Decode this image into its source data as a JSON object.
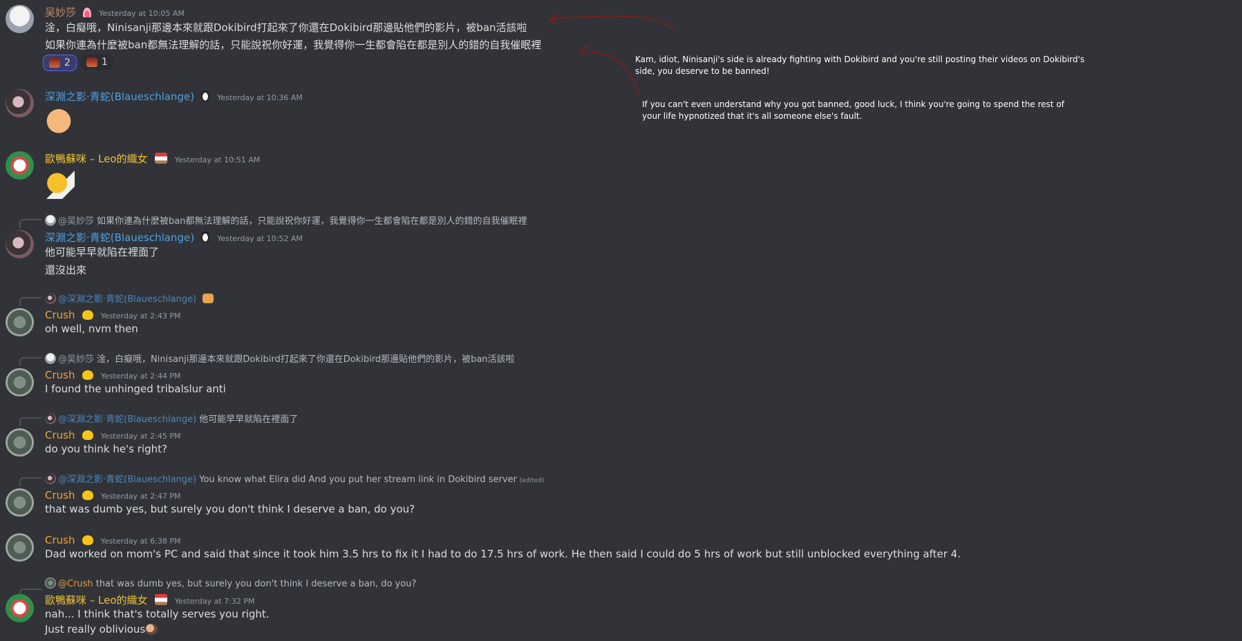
{
  "messages": [
    {
      "username": "吴妙莎",
      "timestamp": "Yesterday at 10:05 AM",
      "lines": [
        "淦，白癡哦，Ninisanji那邊本來就跟Dokibird打起來了你還在Dokibird那邊貼他們的影片，被ban活該啦",
        "如果你連為什麼被ban都無法理解的話，只能說祝你好運，我覺得你一生都會陷在都是別人的錯的自我催眠裡"
      ],
      "reactions": [
        {
          "count": "2"
        },
        {
          "count": "1"
        }
      ]
    },
    {
      "username": "深淵之影·青蛇(Blaueschlange)",
      "timestamp": "Yesterday at 10:36 AM"
    },
    {
      "username": "歐鴨蘇咪 – Leo的織女",
      "timestamp": "Yesterday at 10:51 AM"
    },
    {
      "reply": {
        "mention": "@吴妙莎",
        "text": "如果你連為什麼被ban都無法理解的話，只能說祝你好運，我覺得你一生都會陷在都是別人的錯的自我催眠裡"
      },
      "username": "深淵之影·青蛇(Blaueschlange)",
      "timestamp": "Yesterday at 10:52 AM",
      "lines": [
        "他可能早早就陷在裡面了",
        "還沒出來"
      ]
    },
    {
      "reply": {
        "mention": "@深淵之影·青蛇(Blaueschlange)",
        "text": ""
      },
      "username": "Crush",
      "timestamp": "Yesterday at 2:43 PM",
      "lines": [
        "oh well, nvm then"
      ]
    },
    {
      "reply": {
        "mention": "@吴妙莎",
        "text": "淦，白癡哦，Ninisanji那邊本來就跟Dokibird打起來了你還在Dokibird那邊貼他們的影片，被ban活該啦"
      },
      "username": "Crush",
      "timestamp": "Yesterday at 2:44 PM",
      "lines": [
        "I found the unhinged tribalslur anti"
      ]
    },
    {
      "reply": {
        "mention": "@深淵之影·青蛇(Blaueschlange)",
        "text": "他可能早早就陷在裡面了"
      },
      "username": "Crush",
      "timestamp": "Yesterday at 2:45 PM",
      "lines": [
        "do you think he's right?"
      ]
    },
    {
      "reply": {
        "mention": "@深淵之影·青蛇(Blaueschlange)",
        "text": "You know what Elira did And you put her stream link in Dokibird server",
        "edited": "(edited)"
      },
      "username": "Crush",
      "timestamp": "Yesterday at 2:47 PM",
      "lines": [
        "that was dumb yes, but surely you don't think I deserve a ban, do you?"
      ]
    },
    {
      "username": "Crush",
      "timestamp": "Yesterday at 6:38 PM",
      "lines": [
        "Dad worked on mom's PC and said that since it took him 3.5 hrs to fix it I had to do 17.5 hrs of work. He then said I could do 5 hrs of work but still unblocked everything after 4."
      ]
    },
    {
      "reply": {
        "mention": "@Crush",
        "text": "that was dumb yes, but surely you don't think I deserve a ban, do you?"
      },
      "username": "歐鴨蘇咪 – Leo的織女",
      "timestamp": "Yesterday at 7:32 PM",
      "lines": [
        "nah... I think that's totally serves you right.",
        "Just really oblivious"
      ]
    }
  ],
  "annotations": [
    "Kam, idiot, Ninisanji's side is already fighting with Dokibird and you're still posting their videos on Dokibird's side, you deserve to be banned!",
    "If you can't even understand why you got banned, good luck, I think you're going to spend the rest of your life hypnotized that it's all someone else's fault."
  ],
  "colors": {
    "background": "#313338",
    "wu": "#c38c68",
    "blau": "#4ea0e6",
    "ou": "#f1c232",
    "crush": "#f0a232",
    "annotation_arrow": "#8b1a1a"
  }
}
